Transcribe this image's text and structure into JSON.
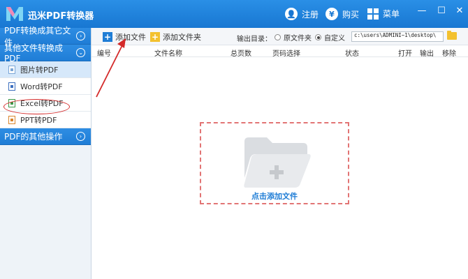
{
  "app": {
    "title": "迅米PDF转换器"
  },
  "titlebar": {
    "register_label": "注册",
    "buy_label": "购买",
    "menu_label": "菜单",
    "minimize": "—",
    "maximize": "☐",
    "close": "✕"
  },
  "sidebar": {
    "groups": [
      {
        "label": "PDF转换成其它文件",
        "chevron": "›"
      },
      {
        "label": "其他文件转换成PDF",
        "chevron": "⌄"
      },
      {
        "label": "PDF的其他操作",
        "chevron": "›"
      }
    ],
    "items": [
      {
        "label": "图片转PDF",
        "icon": "image-file-icon"
      },
      {
        "label": "Word转PDF",
        "icon": "word-file-icon"
      },
      {
        "label": "Excel转PDF",
        "icon": "excel-file-icon"
      },
      {
        "label": "PPT转PDF",
        "icon": "ppt-file-icon"
      }
    ]
  },
  "toolbar": {
    "add_file_label": "添加文件",
    "add_folder_label": "添加文件夹",
    "output_dir_label": "输出目录：",
    "radio_original": "原文件夹",
    "radio_custom": "自定义",
    "output_path": "c:\\users\\ADMINI~1\\desktop\\"
  },
  "table": {
    "headers": [
      "编号",
      "文件名称",
      "总页数",
      "页码选择",
      "状态",
      "打开",
      "输出",
      "移除"
    ]
  },
  "dropzone": {
    "label": "点击添加文件"
  },
  "colors": {
    "accent": "#1f7dd6",
    "annotation": "#d42a2a",
    "dropzone_border": "#e27474"
  }
}
